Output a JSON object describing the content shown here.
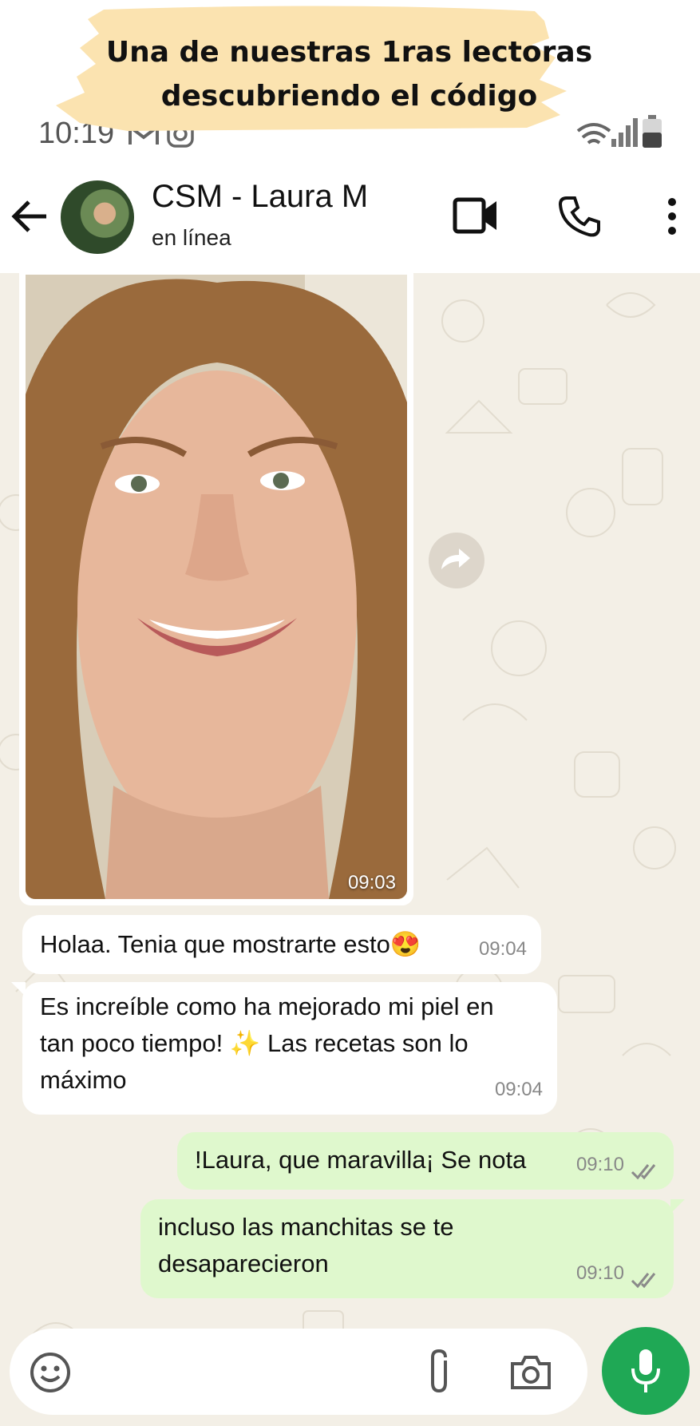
{
  "banner": {
    "line1": "Una de nuestras 1ras lectoras",
    "line2": "descubriendo el código"
  },
  "status": {
    "time": "10:19"
  },
  "header": {
    "contact_name": "CSM - Laura M",
    "presence": "en línea"
  },
  "messages": [
    {
      "direction": "incoming",
      "type": "image",
      "time": "09:03"
    },
    {
      "direction": "incoming",
      "text": "Holaa. Tenia que mostrarte esto😍",
      "time": "09:04"
    },
    {
      "direction": "incoming",
      "line1": "Es increíble como ha mejorado mi piel en",
      "line2": "tan poco tiempo! ✨ Las recetas son lo",
      "line3": "máximo",
      "time": "09:04"
    },
    {
      "direction": "outgoing",
      "text": "!Laura, que maravilla¡ Se nota",
      "time": "09:10"
    },
    {
      "direction": "outgoing",
      "line1": "incluso las manchitas se te",
      "line2": "desaparecieron",
      "time": "09:10"
    }
  ],
  "colors": {
    "banner_highlight": "#fbe3b0",
    "incoming_bubble": "#ffffff",
    "outgoing_bubble": "#dff8cd",
    "chat_background": "#f3efe6",
    "mic_button": "#1fa855"
  },
  "icons": [
    "back-arrow-icon",
    "video-call-icon",
    "phone-icon",
    "more-vert-icon",
    "forward-icon",
    "emoji-icon",
    "attach-icon",
    "camera-icon",
    "mic-icon",
    "double-check-icon",
    "gmail-icon",
    "instagram-icon",
    "wifi-icon",
    "signal-icon",
    "battery-icon"
  ]
}
